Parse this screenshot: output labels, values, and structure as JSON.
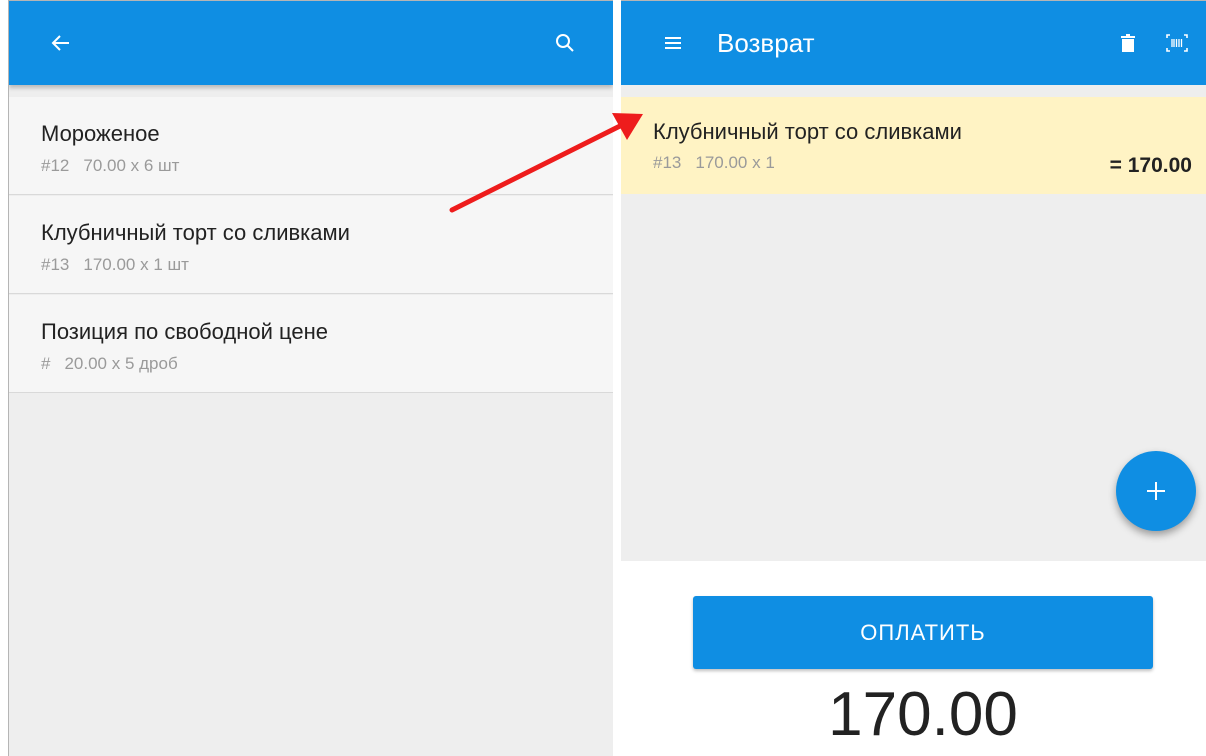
{
  "left_panel": {
    "items": [
      {
        "name": "Мороженое",
        "code": "#12",
        "qty": "70.00 x 6 шт"
      },
      {
        "name": "Клубничный торт со сливками",
        "code": "#13",
        "qty": "170.00 x 1 шт"
      },
      {
        "name": "Позиция по свободной цене",
        "code": "#",
        "qty": "20.00 x 5 дроб"
      }
    ]
  },
  "right_panel": {
    "title": "Возврат",
    "return_item": {
      "name": "Клубничный торт со сливками",
      "code": "#13",
      "qty": "170.00 x 1",
      "sum": "= 170.00"
    },
    "pay_label": "ОПЛАТИТЬ",
    "total": "170.00"
  },
  "colors": {
    "accent": "#0f8ee3",
    "highlight": "#fff3c4",
    "annotation_arrow": "#ee1c1c"
  },
  "icons": [
    "back-arrow-icon",
    "search-icon",
    "menu-icon",
    "trash-icon",
    "barcode-scan-icon",
    "plus-icon"
  ]
}
